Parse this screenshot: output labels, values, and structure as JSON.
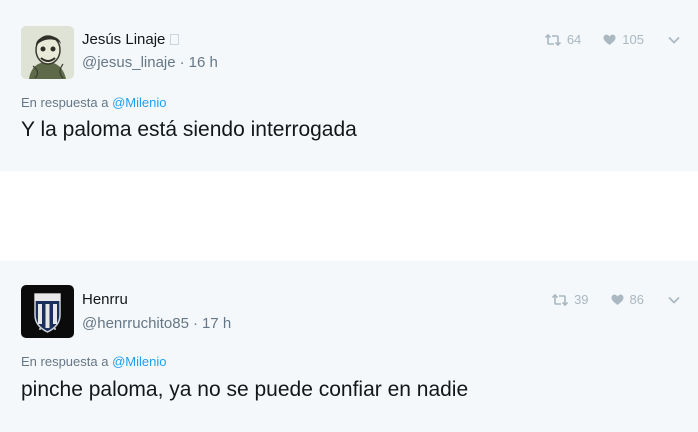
{
  "tweets": [
    {
      "name": "Jesús Linaje",
      "handle": "@jesus_linaje",
      "separator": "·",
      "time": "16 h",
      "reply_prefix": "En respuesta a",
      "reply_to": "@Milenio",
      "text": "Y la paloma está siendo interrogada",
      "retweets": "64",
      "likes": "105",
      "avatar_icon": "caricature-avatar"
    },
    {
      "name": "Henrru",
      "handle": "@henrruchito85",
      "separator": "·",
      "time": "17 h",
      "reply_prefix": "En respuesta a",
      "reply_to": "@Milenio",
      "text": "pinche paloma, ya no se puede confiar en nadie",
      "retweets": "39",
      "likes": "86",
      "avatar_icon": "pachuca-crest-avatar"
    }
  ],
  "colors": {
    "card_bg": "#f5f8fa",
    "muted": "#657786",
    "icon_gray": "#aab8c2",
    "link": "#1da1f2"
  }
}
